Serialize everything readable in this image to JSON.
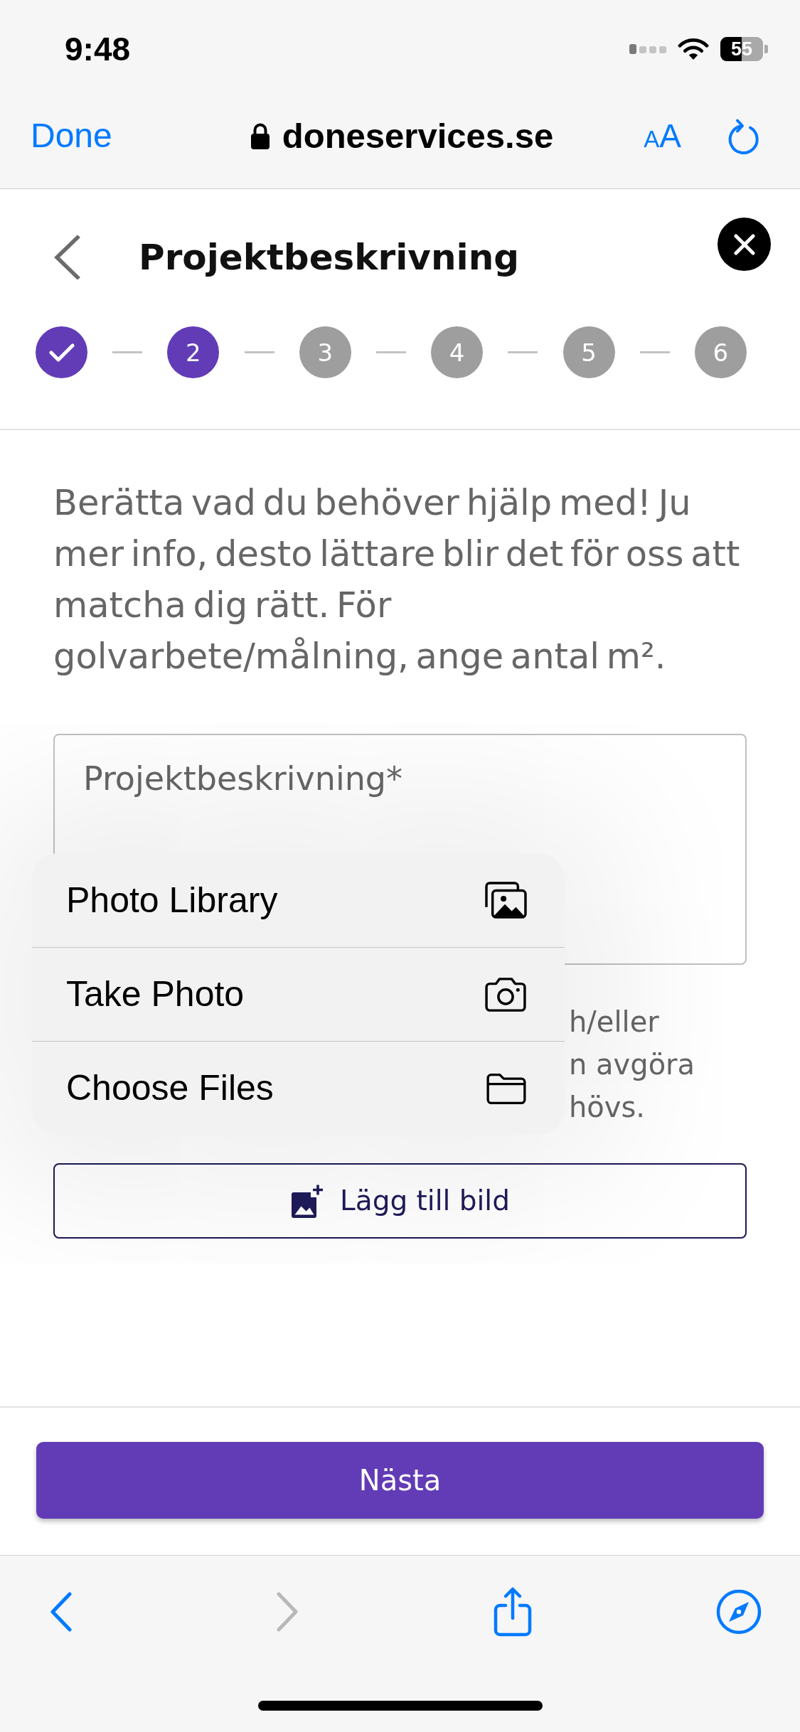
{
  "status_bar": {
    "time": "9:48",
    "battery": "55"
  },
  "browser": {
    "done": "Done",
    "url": "doneservices.se",
    "text_size": "AA"
  },
  "header": {
    "title": "Projektbeskrivning"
  },
  "stepper": {
    "steps": [
      {
        "reached": true,
        "done": true
      },
      {
        "label": "2",
        "reached": true,
        "done": false
      },
      {
        "label": "3",
        "reached": false,
        "done": false
      },
      {
        "label": "4",
        "reached": false,
        "done": false
      },
      {
        "label": "5",
        "reached": false,
        "done": false
      },
      {
        "label": "6",
        "reached": false,
        "done": false
      }
    ]
  },
  "intro": "Berätta vad du behöver hjälp med! Ju mer info, desto lättare blir det för oss att matcha dig rätt. För golvarbete/målning, ange antal m².",
  "description_field": {
    "placeholder": "Projektbeskrivning*"
  },
  "attach_menu": {
    "items": [
      {
        "label": "Photo Library"
      },
      {
        "label": "Take Photo"
      },
      {
        "label": "Choose Files"
      }
    ]
  },
  "hint_fragments": [
    "h/eller",
    "n avgöra",
    "hövs."
  ],
  "add_image_button": "Lägg till bild",
  "next_button": "Nästa",
  "toolbar": {
    "buttons": [
      {
        "disabled": false
      },
      {
        "disabled": true
      },
      {
        "disabled": false
      },
      {
        "disabled": false
      }
    ]
  }
}
